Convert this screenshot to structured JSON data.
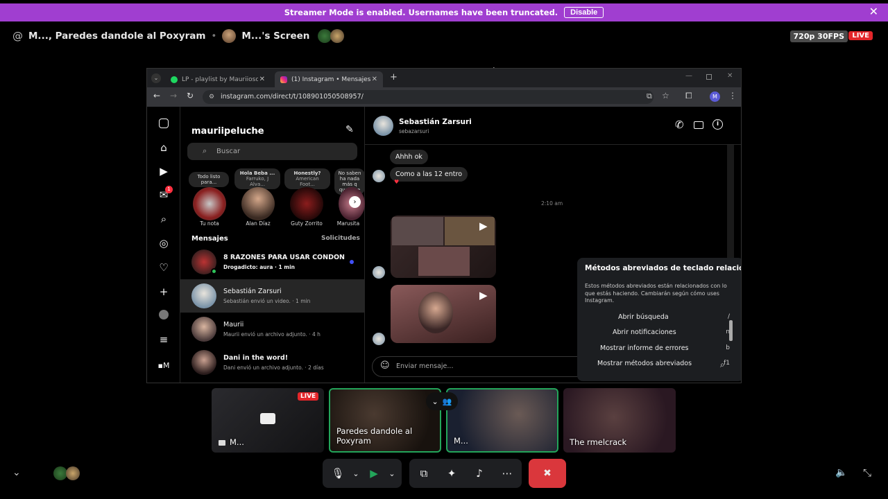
{
  "banner": {
    "text": "Streamer Mode is enabled. Usernames have been truncated.",
    "button": "Disable"
  },
  "header": {
    "channel": "M..., Paredes dandole al Poxyram",
    "screen": "M...'s Screen",
    "resolution": "720p 30FPS",
    "live": "LIVE"
  },
  "browser": {
    "tabs": [
      {
        "label": "LP - playlist by Mauriioso | Spo"
      },
      {
        "label": "(1) Instagram • Mensajes"
      }
    ],
    "url": "instagram.com/direct/t/108901050508957/",
    "profile_initial": "M"
  },
  "instagram": {
    "username": "mauriipeluche",
    "search_placeholder": "Buscar",
    "notes": [
      {
        "bubble": "Todo listo para...",
        "label": "Tu nota"
      },
      {
        "bubble": "Hola Beba ...",
        "sub": "Farruko, J Alva...",
        "label": "Alan Díaz"
      },
      {
        "bubble": "Honestly?",
        "sub": "American Foot...",
        "label": "Guty Zorrito"
      },
      {
        "bubble": "No saben ha nada más q quejarse",
        "label": "Marusita"
      }
    ],
    "messages_heading": "Mensajes",
    "requests_heading": "Solicitudes",
    "threads": [
      {
        "name": "8 RAZONES PARA USAR CONDON",
        "sub": "Drogadicto: aura · 1 min"
      },
      {
        "name": "Sebastián Zarsuri",
        "sub": "Sebastián envió un video. · 1 min"
      },
      {
        "name": "Maurii",
        "sub": "Maurii envió un archivo adjunto. · 4 h"
      },
      {
        "name": "Dani in the word!",
        "sub": "Dani envió un archivo adjunto. · 2 días"
      }
    ],
    "chat": {
      "name": "Sebastián Zarsuri",
      "handle": "sebazarsuri",
      "msg1": "Ahhh ok",
      "msg2": "Como a las 12 entro",
      "time": "2:10 am",
      "composer_placeholder": "Enviar mensaje..."
    },
    "shortcuts": {
      "title": "Métodos abreviados de teclado relacionad",
      "desc": "Estos métodos abreviados están relacionados con lo que estás haciendo. Cambiarán según cómo uses Instagram.",
      "rows": [
        {
          "label": "Abrir búsqueda",
          "key": "/"
        },
        {
          "label": "Abrir notificaciones",
          "key": "n"
        },
        {
          "label": "Mostrar informe de errores",
          "key": "b"
        },
        {
          "label": "Mostrar métodos abreviados",
          "key": "f1"
        }
      ]
    },
    "notif_count": "1"
  },
  "tiles": [
    {
      "label": "M...",
      "live": "LIVE"
    },
    {
      "label": "Paredes dandole al Poxyram"
    },
    {
      "label": "M..."
    },
    {
      "label": "The rmelcrack"
    }
  ],
  "colors": {
    "banner": "#a03ed0",
    "live": "#e3262a",
    "speaking": "#23a55a",
    "hangup": "#da373c",
    "ig_unread": "#4150f7"
  }
}
